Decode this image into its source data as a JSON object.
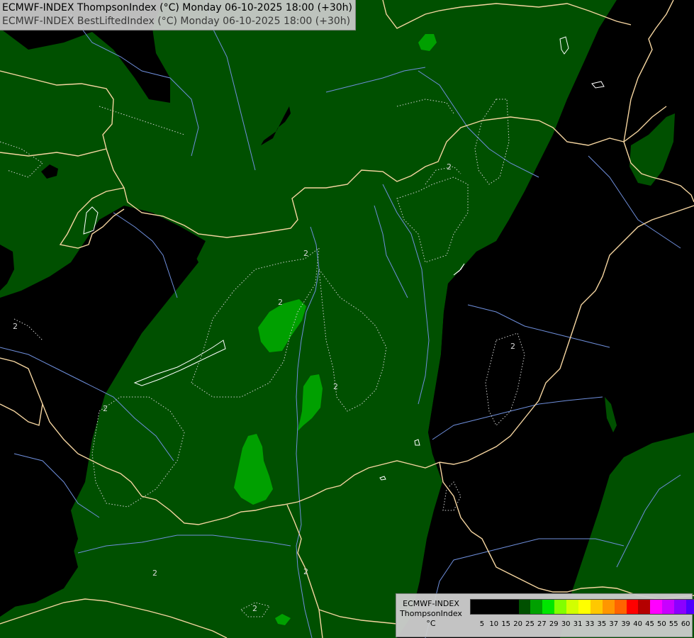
{
  "title": {
    "line1": "ECMWF-INDEX ThompsonIndex (°C) Monday 06-10-2025 18:00 (+30h)",
    "line2": "ECMWF-INDEX BestLiftedIndex (°C) Monday 06-10-2025 18:00 (+30h)"
  },
  "legend": {
    "model": "ECMWF-INDEX",
    "parameter": "ThompsonIndex",
    "unit": "°C",
    "colors": [
      "#000000",
      "#000000",
      "#000000",
      "#000000",
      "#005000",
      "#00a000",
      "#00e600",
      "#82ff00",
      "#d2ff00",
      "#ffff00",
      "#ffc800",
      "#ff9600",
      "#ff6400",
      "#ff0000",
      "#b40000",
      "#ff00ff",
      "#c800ff",
      "#8c00ff",
      "#5000ff",
      "#0000ff"
    ],
    "ticks": [
      "5",
      "10",
      "15",
      "20",
      "25",
      "27",
      "29",
      "30",
      "31",
      "33",
      "35",
      "37",
      "39",
      "40",
      "45",
      "50",
      "55",
      "60"
    ]
  },
  "contour_labels": [
    "2",
    "2",
    "2",
    "2",
    "2",
    "2",
    "2",
    "2",
    "2",
    "2"
  ],
  "colors": {
    "dark_green": "#005000",
    "mid_green": "#00a000",
    "background": "#000000",
    "borders": "#f5d5a0",
    "rivers": "#6f8fdc",
    "contours": "#c8c8c8"
  }
}
